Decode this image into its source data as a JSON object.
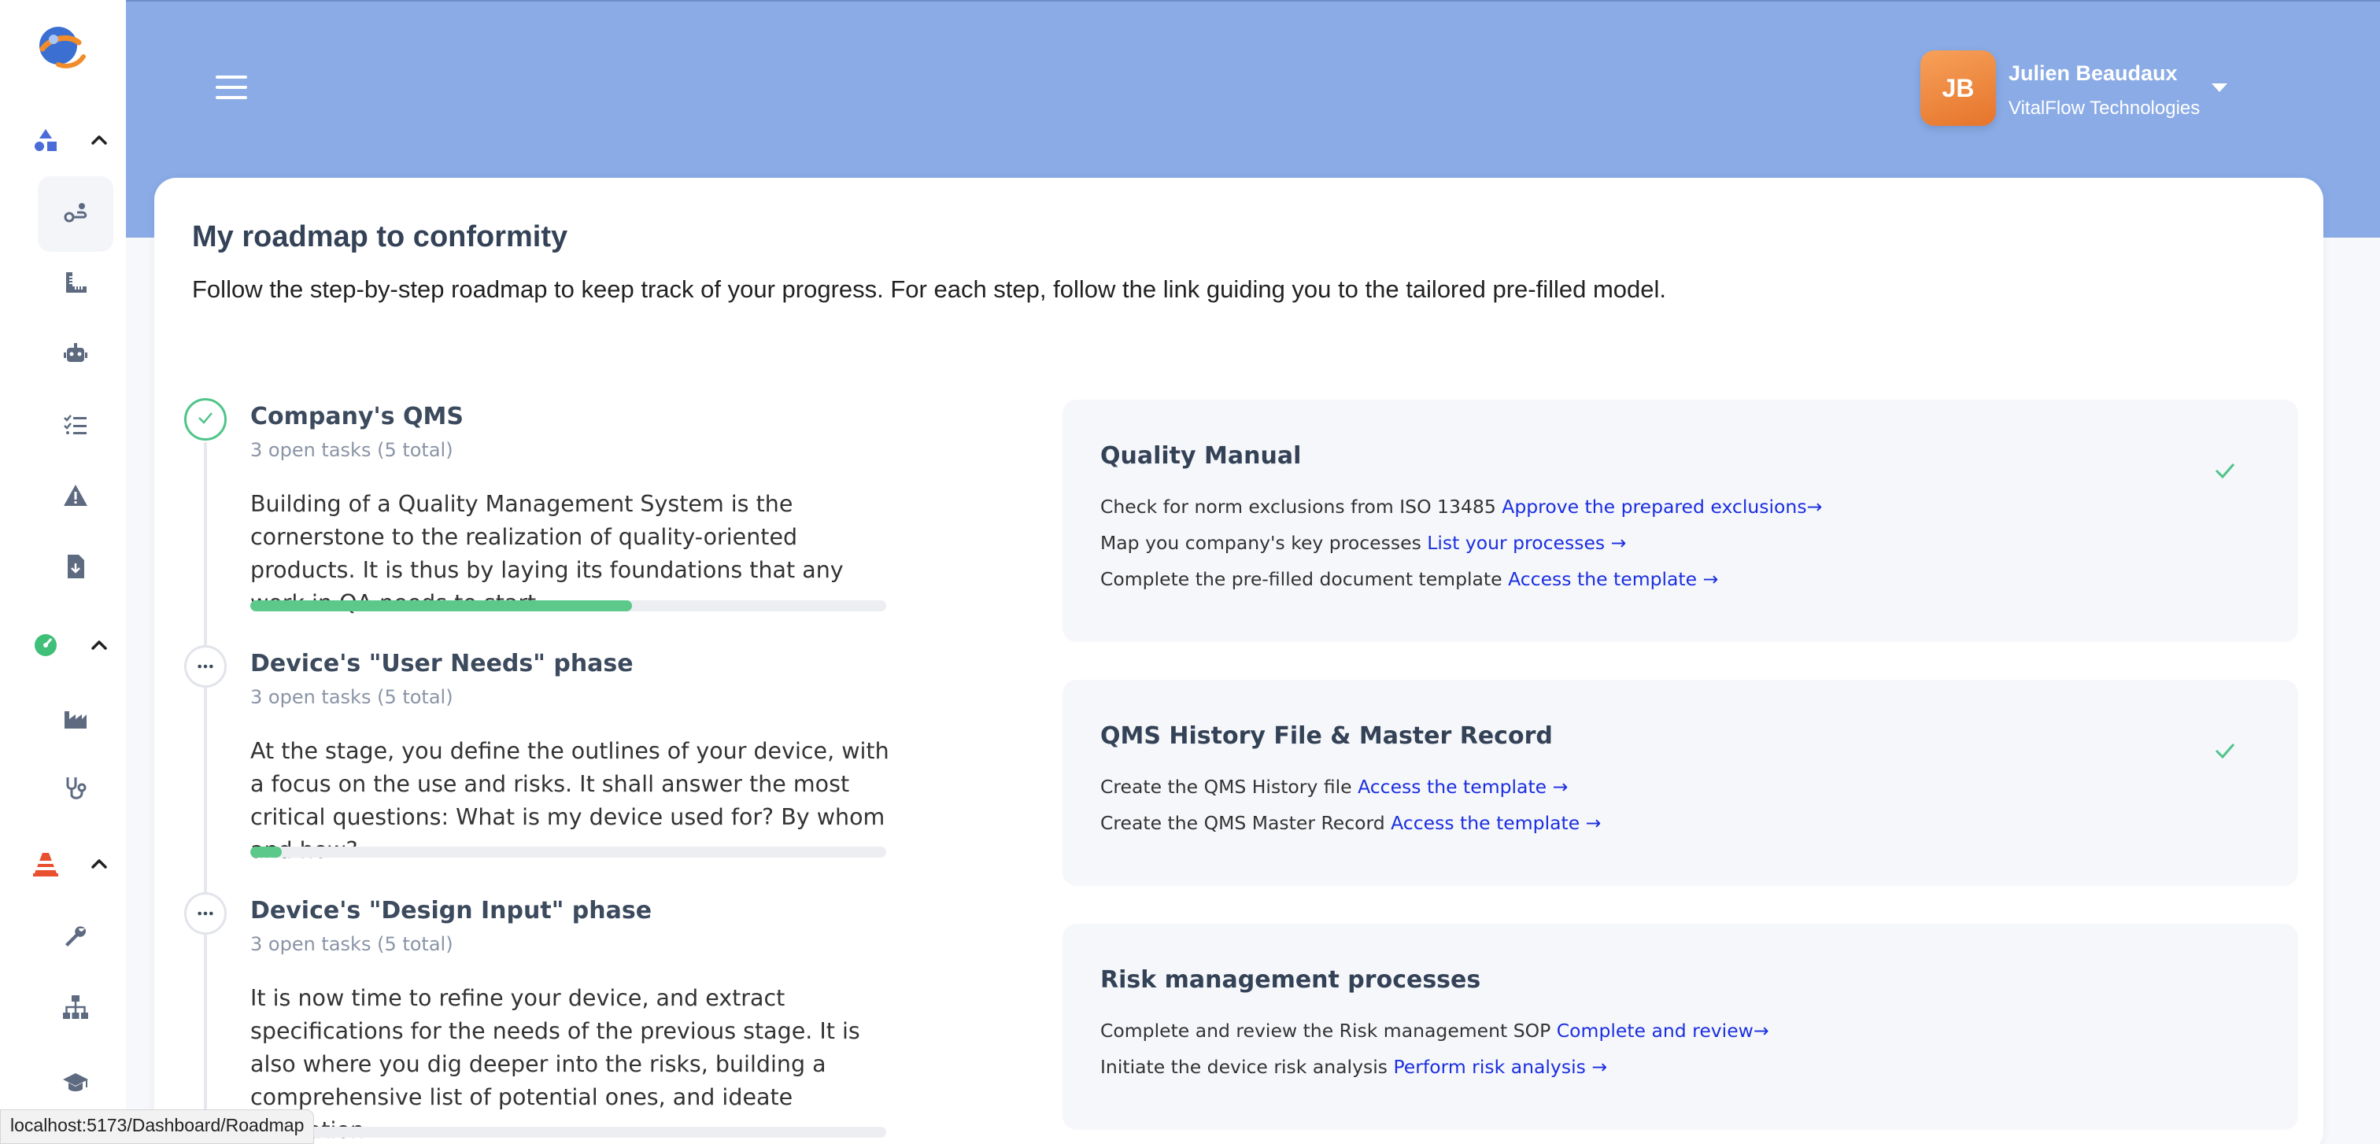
{
  "colors": {
    "header": "#8aabe6",
    "accent_green": "#5cc88a",
    "link": "#1a2ee0",
    "avatar": "#ef8a3d",
    "card_bg": "#f6f7fa"
  },
  "sidebar": {
    "logo": "app-logo",
    "groups": [
      {
        "icon": "shapes-icon",
        "expanded": true,
        "items": [
          {
            "icon": "roadmap-icon",
            "active": true
          },
          {
            "icon": "ruler-icon",
            "active": false
          },
          {
            "icon": "robot-icon",
            "active": false
          },
          {
            "icon": "checklist-icon",
            "active": false
          },
          {
            "icon": "warning-icon",
            "active": false
          },
          {
            "icon": "file-download-icon",
            "active": false
          }
        ]
      },
      {
        "icon": "dashboard-gauge-icon",
        "expanded": true,
        "items": [
          {
            "icon": "factory-icon",
            "active": false
          },
          {
            "icon": "stethoscope-icon",
            "active": false
          }
        ]
      },
      {
        "icon": "traffic-cone-icon",
        "expanded": true,
        "items": [
          {
            "icon": "wrench-icon",
            "active": false
          },
          {
            "icon": "sitemap-icon",
            "active": false
          },
          {
            "icon": "graduation-cap-icon",
            "active": false
          }
        ]
      }
    ]
  },
  "header": {
    "menu_icon": "hamburger-icon",
    "user": {
      "initials": "JB",
      "name": "Julien Beaudaux",
      "company": "VitalFlow Technologies"
    }
  },
  "page": {
    "title": "My roadmap to conformity",
    "subtitle": "Follow the step-by-step roadmap to keep track of your progress. For each step, follow the link guiding you to the tailored pre-filled model."
  },
  "steps": [
    {
      "title": "Company's QMS",
      "count": "3 open tasks (5 total)",
      "status": "done",
      "description": "Building of a Quality Management System is the cornerstone to the realization of quality-oriented products. It is thus by laying its foundations that any work in QA needs to start.",
      "progress": 0.6
    },
    {
      "title": "Device's \"User Needs\" phase",
      "count": "3 open tasks (5 total)",
      "status": "pending",
      "description": "At the stage, you define the outlines of your device, with a focus on the use and risks. It shall answer the most critical questions: What is my device used for? By whom and how?",
      "progress": 0.05
    },
    {
      "title": "Device's \"Design Input\" phase",
      "count": "3 open tasks (5 total)",
      "status": "pending",
      "description": "It is now time to refine your device, and extract specifications for the needs of the previous stage. It is also where you dig deeper into the risks, building a comprehensive list of potential ones, and ideate mitigation.",
      "progress": 0.0
    }
  ],
  "cards": [
    {
      "title": "Quality Manual",
      "completed": true,
      "tasks": [
        {
          "text": "Check for norm exclusions from ISO 13485 ",
          "link": "Approve the prepared exclusions"
        },
        {
          "text": "Map you company's key processes ",
          "link": "List your processes"
        },
        {
          "text": "Complete the pre-filled document template ",
          "link": "Access the template"
        }
      ]
    },
    {
      "title": "QMS History File & Master Record",
      "completed": true,
      "tasks": [
        {
          "text": "Create the QMS History file ",
          "link": "Access the template"
        },
        {
          "text": "Create the QMS Master Record ",
          "link": "Access the template"
        }
      ]
    },
    {
      "title": "Risk management processes",
      "completed": false,
      "tasks": [
        {
          "text": "Complete and review the Risk management SOP ",
          "link": "Complete and review"
        },
        {
          "text": "Initiate the device risk analysis ",
          "link": "Perform risk analysis"
        }
      ]
    }
  ],
  "status_bar": {
    "url": "localhost:5173/Dashboard/Roadmap"
  }
}
